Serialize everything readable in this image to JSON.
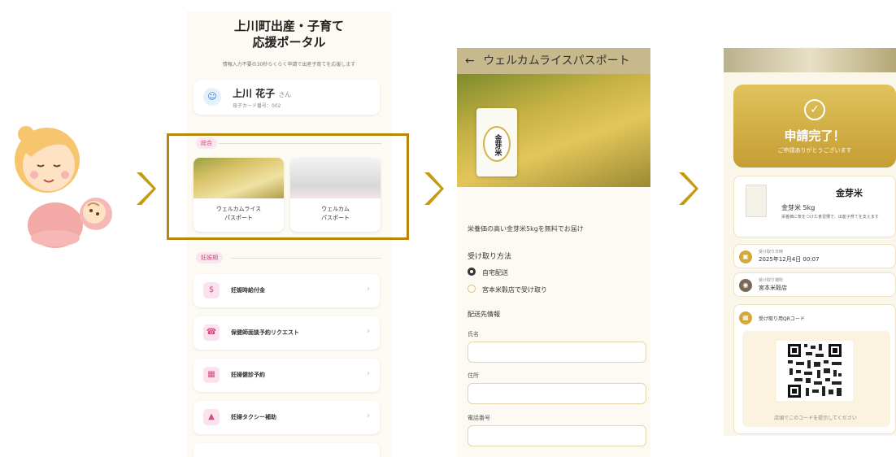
{
  "portal": {
    "title_line1": "上川町出産・子育て",
    "title_line2": "応援ポータル",
    "subtitle": "情報入力不要の30秒らくらく申請で出産子育てを応援します",
    "user_name": "上川 花子",
    "user_suffix": "さん",
    "user_id": "母子カード番号：002",
    "section_general": "総合",
    "passes": [
      {
        "line1": "ウェルカムライス",
        "line2": "パスポート"
      },
      {
        "line1": "ウェルカム",
        "line2": "パスポート"
      }
    ],
    "section_pregnancy": "妊娠期",
    "menu": [
      {
        "label": "妊娠時給付金",
        "icon": "$"
      },
      {
        "label": "保健師面談予約リクエスト",
        "icon": "☎"
      },
      {
        "label": "妊婦健診予約",
        "icon": "▦"
      },
      {
        "label": "妊婦タクシー補助",
        "icon": "🚕"
      }
    ],
    "chevron": "›"
  },
  "rice": {
    "header": "ウェルカムライスパスポート",
    "back": "←",
    "bag_brand": "金芽米",
    "description": "栄養価の高い金芽米5kgを無料でお届け",
    "method_heading": "受け取り方法",
    "options": [
      "自宅配送",
      "宮本米穀店で受け取り"
    ],
    "delivery_heading": "配送先情報",
    "fields": [
      "氏名",
      "住所",
      "電話番号"
    ]
  },
  "complete": {
    "check": "✓",
    "title": "申請完了！",
    "subtitle": "ご申請ありがとうございます",
    "product_name": "金芽米",
    "product_size": "金芽米 5kg",
    "product_note": "栄養価に気をつけた食習慣で、出産子育てを支えます",
    "date_label": "受け取り日時",
    "date_value": "2025年12月4日 00:07",
    "place_label": "受け取り場所",
    "place_value": "宮本米穀店",
    "qr_label": "受け取り用QRコード",
    "qr_note": "店頭でこのコードを提示してください"
  },
  "colors": {
    "accent": "#c49a0f",
    "pink": "#d24b82",
    "gold": "#d3b04a"
  }
}
